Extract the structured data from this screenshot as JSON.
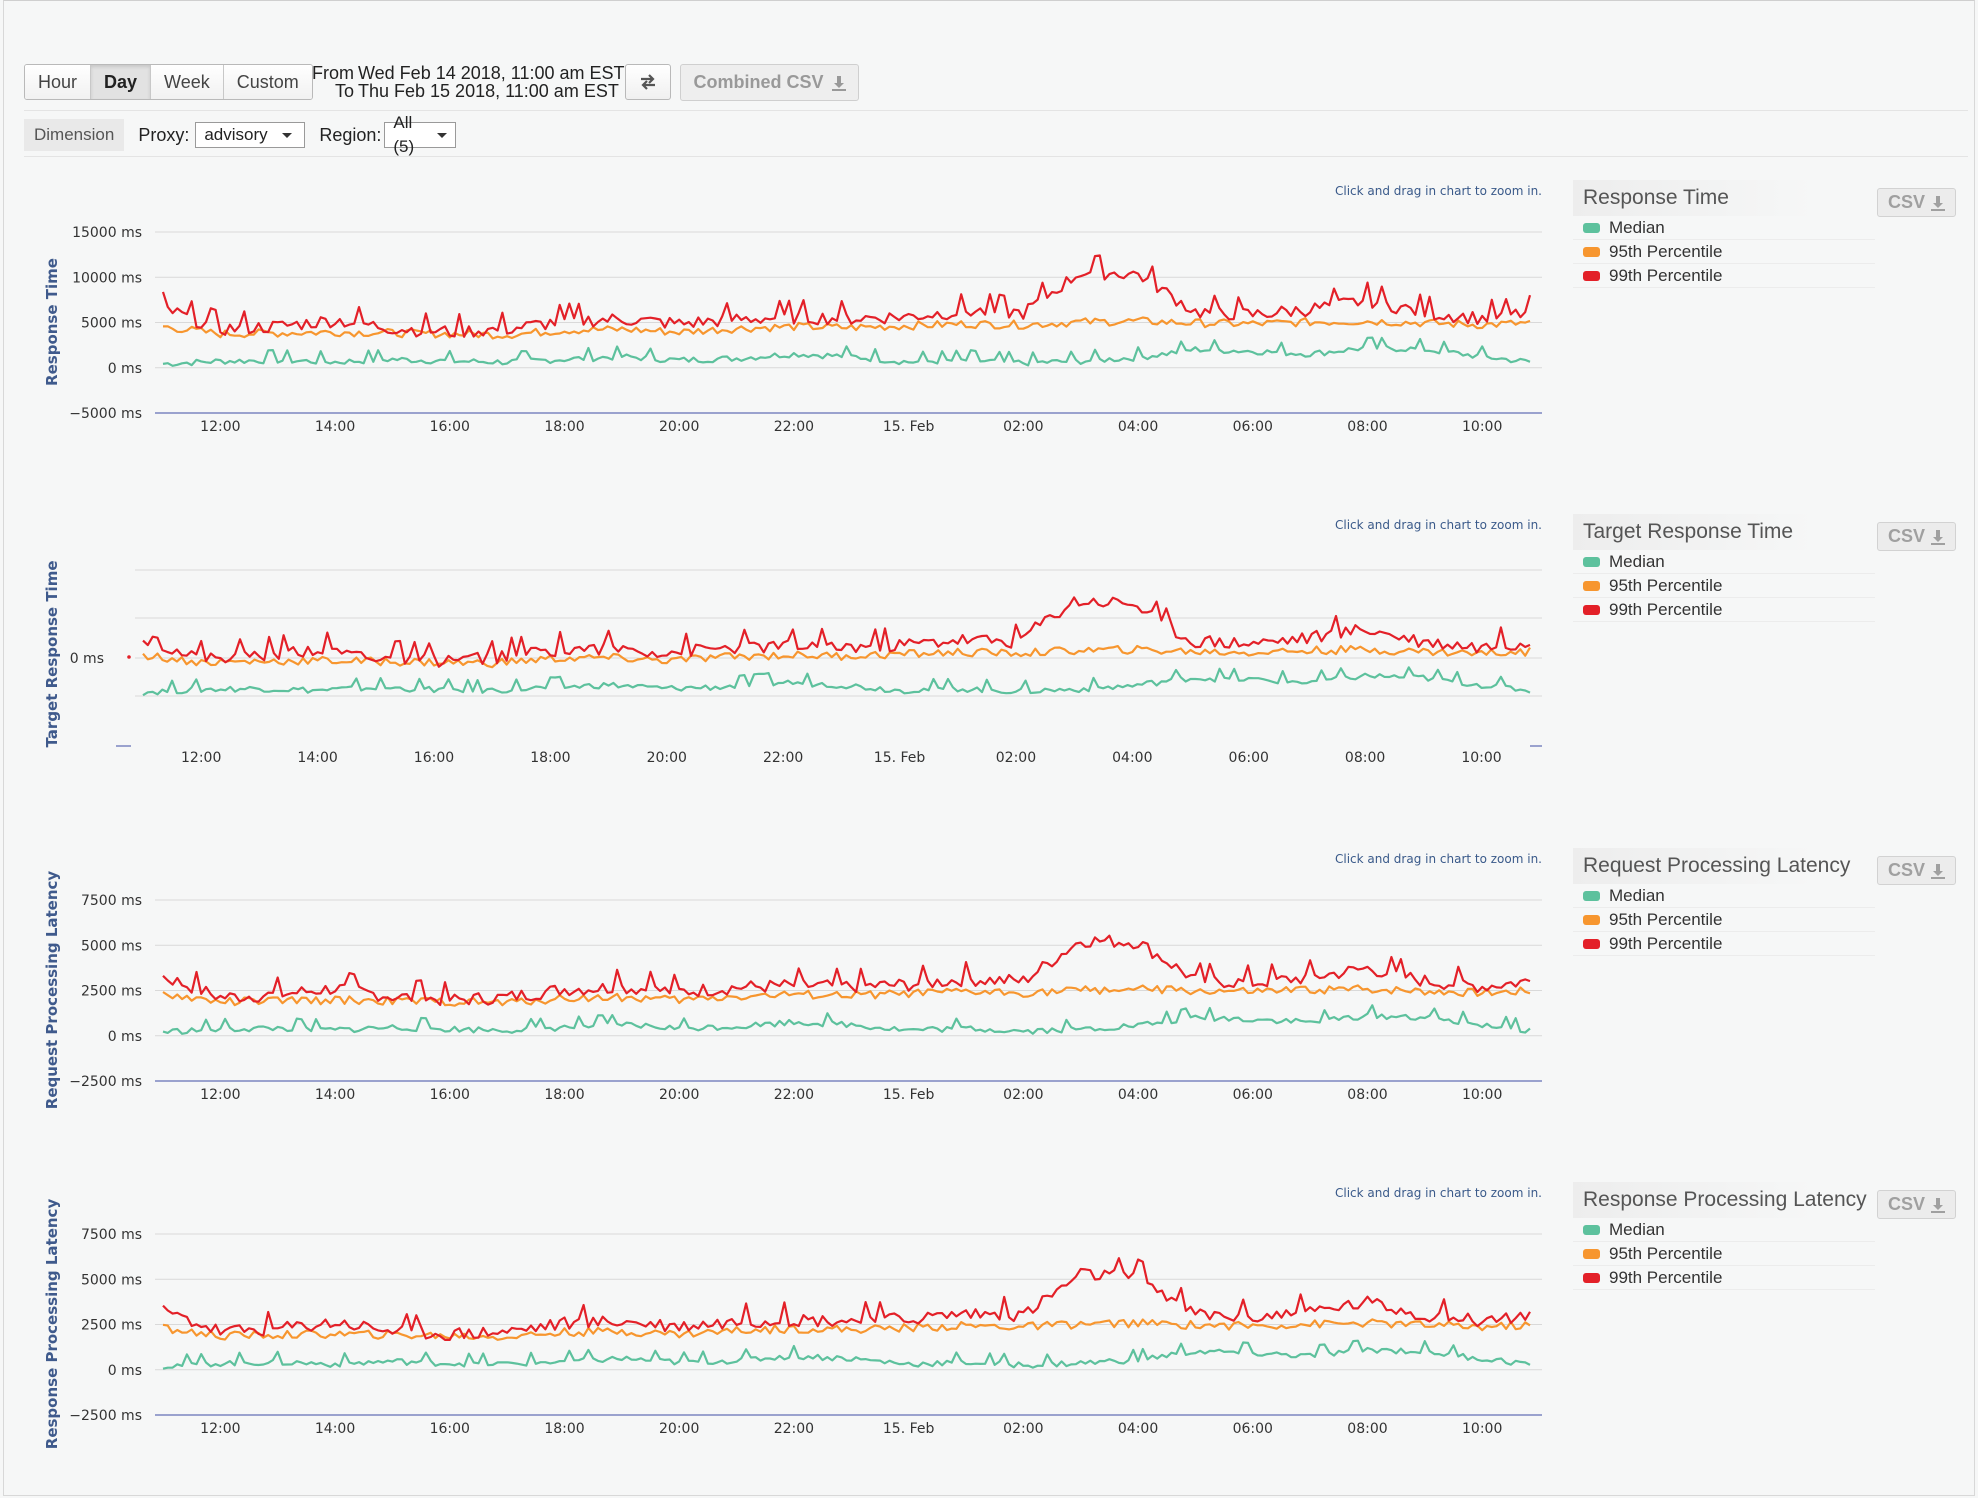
{
  "toolbar": {
    "range_buttons": [
      "Hour",
      "Day",
      "Week",
      "Custom"
    ],
    "active_range": "Day",
    "from_label": "From",
    "from_value": "Wed Feb 14 2018, 11:00 am EST",
    "to_label": "To",
    "to_value": "Thu Feb 15 2018, 11:00 am EST",
    "swap_icon": "swap-arrows-icon",
    "combined_csv_label": "Combined CSV",
    "download_icon": "download-icon"
  },
  "filters": {
    "dimension_label": "Dimension",
    "proxy_label": "Proxy:",
    "proxy_value": "advisory",
    "region_label": "Region:",
    "region_value": "All (5)"
  },
  "zoom_hint": "Click and drag in chart to zoom in.",
  "csv_label": "CSV",
  "colors": {
    "median": "#5dc19d",
    "p95": "#f7962f",
    "p99": "#e32028",
    "axis": "#7b86c0",
    "grid": "#d9d9d9"
  },
  "legend_items": [
    "Median",
    "95th Percentile",
    "99th Percentile"
  ],
  "x_tick_labels": [
    "12:00",
    "14:00",
    "16:00",
    "18:00",
    "20:00",
    "22:00",
    "15. Feb",
    "02:00",
    "04:00",
    "06:00",
    "08:00",
    "10:00"
  ],
  "chart_data": [
    {
      "type": "line",
      "title": "Response Time",
      "ylabel": "Response Time",
      "yticks": [
        "15000 ms",
        "10000 ms",
        "5000 ms",
        "0 ms",
        "−5000 ms"
      ],
      "ylim": [
        -5000,
        15000
      ],
      "x": [
        "11:00",
        "12:00",
        "13:00",
        "14:00",
        "15:00",
        "16:00",
        "17:00",
        "18:00",
        "19:00",
        "20:00",
        "21:00",
        "22:00",
        "23:00",
        "00:00",
        "01:00",
        "02:00",
        "03:00",
        "04:00",
        "05:00",
        "06:00",
        "07:00",
        "08:00",
        "09:00",
        "10:00",
        "10:50"
      ],
      "series": [
        {
          "name": "Median",
          "values": [
            400,
            700,
            800,
            600,
            900,
            700,
            600,
            900,
            1200,
            800,
            1000,
            1500,
            1200,
            600,
            800,
            500,
            700,
            1100,
            2000,
            1800,
            1500,
            2200,
            2000,
            1200,
            600
          ]
        },
        {
          "name": "95th Percentile",
          "values": [
            4500,
            3700,
            3800,
            3900,
            3800,
            3700,
            3600,
            4100,
            4200,
            3900,
            4300,
            4500,
            4400,
            4600,
            4800,
            4700,
            5000,
            5100,
            4900,
            4800,
            5000,
            5100,
            4900,
            4700,
            4900
          ]
        },
        {
          "name": "99th Percentile",
          "values": [
            6500,
            4200,
            4500,
            5200,
            4300,
            3900,
            4200,
            5100,
            5300,
            4800,
            5300,
            5500,
            5400,
            5600,
            6200,
            6000,
            10500,
            10300,
            6100,
            5800,
            6400,
            7400,
            6000,
            5400,
            6000
          ]
        }
      ]
    },
    {
      "type": "line",
      "title": "Target Response Time",
      "ylabel": "Target Response Time",
      "yticks": [
        "0 ms"
      ],
      "x": [
        "11:00",
        "12:00",
        "13:00",
        "14:00",
        "15:00",
        "16:00",
        "17:00",
        "18:00",
        "19:00",
        "20:00",
        "21:00",
        "22:00",
        "23:00",
        "00:00",
        "01:00",
        "02:00",
        "03:00",
        "04:00",
        "05:00",
        "06:00",
        "07:00",
        "08:00",
        "09:00",
        "10:00",
        "10:50"
      ],
      "series": [
        {
          "name": "Median",
          "values": [
            0.4,
            0.7,
            0.8,
            0.6,
            0.9,
            0.7,
            0.6,
            0.9,
            1.2,
            0.8,
            1.0,
            1.5,
            1.2,
            0.6,
            0.8,
            0.5,
            0.7,
            1.1,
            2.0,
            1.8,
            1.5,
            2.2,
            2.0,
            1.2,
            0.6
          ]
        },
        {
          "name": "95th Percentile",
          "values": [
            4.5,
            3.7,
            3.8,
            3.9,
            3.8,
            3.7,
            3.6,
            4.1,
            4.2,
            3.9,
            4.3,
            4.5,
            4.4,
            4.6,
            4.8,
            4.7,
            5.0,
            5.1,
            4.9,
            4.8,
            5.0,
            5.1,
            4.9,
            4.7,
            4.9
          ]
        },
        {
          "name": "99th Percentile",
          "values": [
            6.5,
            4.2,
            4.5,
            5.2,
            4.3,
            3.9,
            4.2,
            5.1,
            5.3,
            4.8,
            5.3,
            5.5,
            5.4,
            5.6,
            6.2,
            6.0,
            10.5,
            10.3,
            6.1,
            5.8,
            6.4,
            7.4,
            6.0,
            5.4,
            6.0
          ]
        }
      ]
    },
    {
      "type": "line",
      "title": "Request Processing Latency",
      "ylabel": "Request Processing Latency",
      "yticks": [
        "7500 ms",
        "5000 ms",
        "2500 ms",
        "0 ms",
        "−2500 ms"
      ],
      "ylim": [
        -2500,
        7500
      ],
      "x": [
        "11:00",
        "12:00",
        "13:00",
        "14:00",
        "15:00",
        "16:00",
        "17:00",
        "18:00",
        "19:00",
        "20:00",
        "21:00",
        "22:00",
        "23:00",
        "00:00",
        "01:00",
        "02:00",
        "03:00",
        "04:00",
        "05:00",
        "06:00",
        "07:00",
        "08:00",
        "09:00",
        "10:00",
        "10:50"
      ],
      "series": [
        {
          "name": "Median",
          "values": [
            200,
            350,
            400,
            300,
            450,
            350,
            300,
            450,
            600,
            400,
            500,
            750,
            600,
            300,
            400,
            250,
            350,
            550,
            1000,
            900,
            750,
            1100,
            1000,
            600,
            300
          ]
        },
        {
          "name": "95th Percentile",
          "values": [
            2250,
            1850,
            1900,
            1950,
            1900,
            1850,
            1800,
            2050,
            2100,
            1950,
            2150,
            2250,
            2200,
            2300,
            2400,
            2350,
            2500,
            2550,
            2450,
            2400,
            2500,
            2550,
            2450,
            2350,
            2450
          ]
        },
        {
          "name": "99th Percentile",
          "values": [
            3250,
            2100,
            2250,
            2600,
            2150,
            1950,
            2100,
            2550,
            2650,
            2400,
            2650,
            2750,
            2700,
            2800,
            3100,
            3000,
            5250,
            5150,
            3050,
            2900,
            3200,
            3700,
            3000,
            2700,
            3000
          ]
        }
      ]
    },
    {
      "type": "line",
      "title": "Response Processing Latency",
      "ylabel": "Response Processing Latency",
      "yticks": [
        "7500 ms",
        "5000 ms",
        "2500 ms",
        "0 ms",
        "−2500 ms"
      ],
      "ylim": [
        -2500,
        7500
      ],
      "x": [
        "11:00",
        "12:00",
        "13:00",
        "14:00",
        "15:00",
        "16:00",
        "17:00",
        "18:00",
        "19:00",
        "20:00",
        "21:00",
        "22:00",
        "23:00",
        "00:00",
        "01:00",
        "02:00",
        "03:00",
        "04:00",
        "05:00",
        "06:00",
        "07:00",
        "08:00",
        "09:00",
        "10:00",
        "10:50"
      ],
      "series": [
        {
          "name": "Median",
          "values": [
            200,
            350,
            400,
            300,
            450,
            350,
            300,
            450,
            600,
            400,
            500,
            750,
            600,
            300,
            400,
            250,
            350,
            550,
            1000,
            900,
            750,
            1100,
            1000,
            600,
            300
          ]
        },
        {
          "name": "95th Percentile",
          "values": [
            2250,
            1850,
            1900,
            1950,
            1900,
            1850,
            1800,
            2050,
            2100,
            1950,
            2150,
            2250,
            2200,
            2300,
            2400,
            2350,
            2500,
            2550,
            2450,
            2400,
            2500,
            2550,
            2450,
            2350,
            2450
          ]
        },
        {
          "name": "99th Percentile",
          "values": [
            3250,
            2100,
            2250,
            2600,
            2150,
            1950,
            2100,
            2550,
            2650,
            2400,
            2650,
            2750,
            2700,
            2800,
            3100,
            3000,
            5250,
            5150,
            3050,
            2900,
            3200,
            3700,
            3000,
            2700,
            3000
          ]
        }
      ]
    }
  ]
}
